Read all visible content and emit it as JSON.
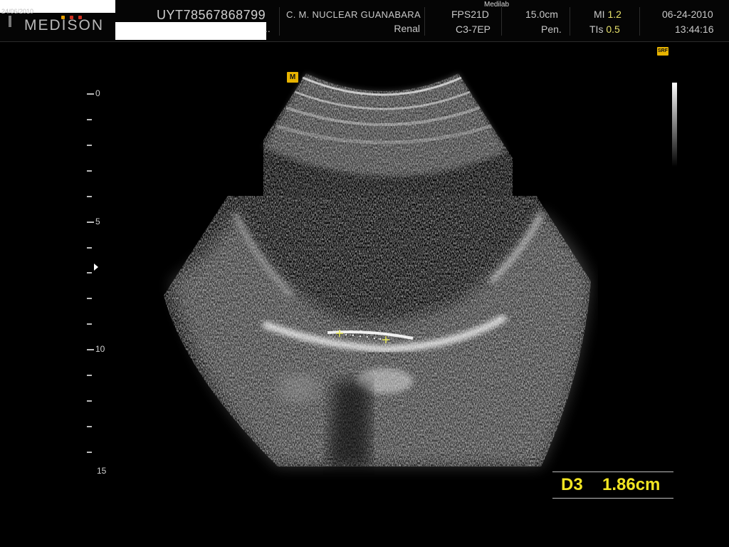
{
  "header": {
    "top_date_fragment": "24/06/2010",
    "logo_text": "MEDISON",
    "patient_id": "UYT78567868799",
    "ellipsis": "..",
    "institution": "C. M. NUCLEAR  GUANABARA",
    "exam": "Renal",
    "site_label": "Medilab",
    "probe_preset": "FPS21D",
    "probe": "C3-7EP",
    "depth": "15.0cm",
    "mode": "Pen.",
    "mi_label": "MI",
    "mi_value": "1.2",
    "tis_label": "TIs",
    "tis_value": "0.5",
    "date": "06-24-2010",
    "time": "13:44:16"
  },
  "badges": {
    "srf": "SRF",
    "marker": "M"
  },
  "depth_scale": {
    "labels": [
      "0",
      "5",
      "10",
      "15"
    ]
  },
  "measurement": {
    "label": "D3",
    "value": "1.86cm"
  },
  "colors": {
    "measurement": "#f2e522",
    "badge": "#e8b400",
    "background": "#000000"
  }
}
